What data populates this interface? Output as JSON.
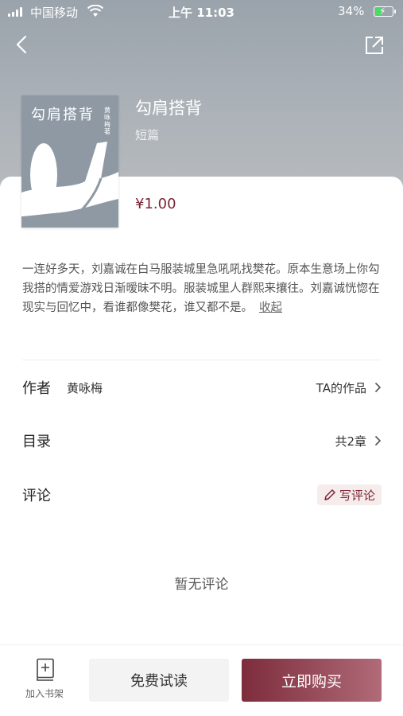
{
  "status_bar": {
    "carrier": "中国移动",
    "time": "上午 11:03",
    "battery_percent": "34%"
  },
  "book": {
    "title": "勾肩搭背",
    "cover_title": "勾肩搭背",
    "cover_author": "黄咏梅 著",
    "type": "短篇",
    "price": "¥1.00",
    "description": "一连好多天，刘嘉诚在白马服装城里急吼吼找樊花。原本生意场上你勾我搭的情爱游戏日渐暧昧不明。服装城里人群熙来攘往。刘嘉诚恍惚在现实与回忆中，看谁都像樊花，谁又都不是。",
    "collapse_label": "收起"
  },
  "author_row": {
    "label": "作者",
    "name": "黄咏梅",
    "link": "TA的作品"
  },
  "toc_row": {
    "label": "目录",
    "count": "共2章"
  },
  "comment_row": {
    "label": "评论",
    "write_label": "写评论"
  },
  "comments_empty": "暂无评论",
  "bottom_bar": {
    "shelf_label": "加入书架",
    "trial_label": "免费试读",
    "buy_label": "立即购买"
  },
  "colors": {
    "accent": "#7a2434",
    "buy_gradient_start": "#7d2c3c",
    "buy_gradient_end": "#b06a78"
  },
  "icons": [
    "back-icon",
    "share-icon",
    "chevron-right-icon",
    "pencil-icon",
    "bookshelf-add-icon"
  ]
}
